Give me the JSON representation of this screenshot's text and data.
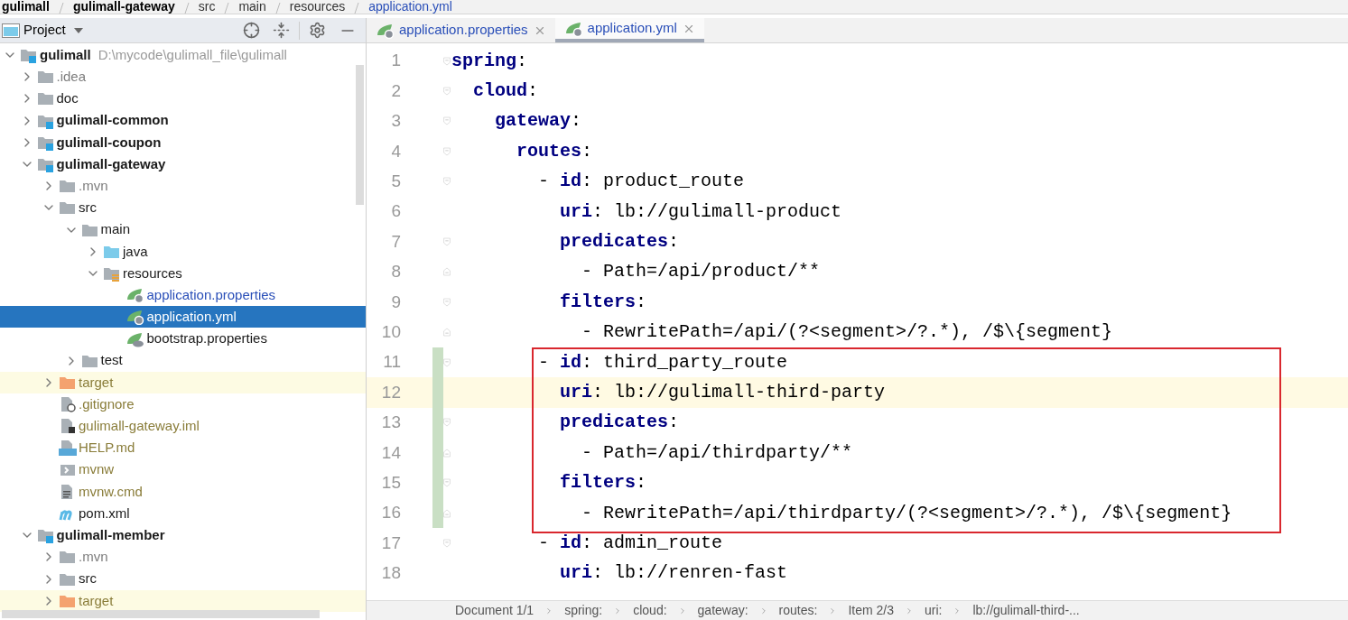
{
  "breadcrumbs": [
    "gulimall",
    "gulimall-gateway",
    "src",
    "main",
    "resources",
    "application.yml"
  ],
  "project_panel": {
    "title": "Project"
  },
  "tree": [
    {
      "label": "gulimall",
      "path": "D:\\mycode\\gulimall_file\\gulimall",
      "kind": "module",
      "color": "#1a1a1a",
      "expanded": true,
      "selected": false,
      "children": [
        {
          "label": ".idea",
          "kind": "folder",
          "color": "#7d7d7d",
          "expanded": false,
          "selected": false
        },
        {
          "label": "doc",
          "kind": "folder",
          "color": "#1a1a1a",
          "expanded": false,
          "selected": false
        },
        {
          "label": "gulimall-common",
          "kind": "module",
          "color": "#1a1a1a",
          "expanded": false,
          "selected": false
        },
        {
          "label": "gulimall-coupon",
          "kind": "module",
          "color": "#1a1a1a",
          "expanded": false,
          "selected": false
        },
        {
          "label": "gulimall-gateway",
          "kind": "module",
          "color": "#1a1a1a",
          "expanded": true,
          "selected": false,
          "children": [
            {
              "label": ".mvn",
              "kind": "folder",
              "color": "#7d7d7d",
              "expanded": false,
              "selected": false
            },
            {
              "label": "src",
              "kind": "folder",
              "color": "#1a1a1a",
              "expanded": true,
              "selected": false,
              "children": [
                {
                  "label": "main",
                  "kind": "folder",
                  "color": "#1a1a1a",
                  "expanded": true,
                  "selected": false,
                  "children": [
                    {
                      "label": "java",
                      "kind": "source-folder",
                      "color": "#1a1a1a",
                      "expanded": false,
                      "selected": false
                    },
                    {
                      "label": "resources",
                      "kind": "resource-folder",
                      "color": "#1a1a1a",
                      "expanded": true,
                      "selected": false,
                      "children": [
                        {
                          "label": "application.properties",
                          "kind": "spring-config",
                          "color": "#2a4fb8",
                          "selected": false
                        },
                        {
                          "label": "application.yml",
                          "kind": "spring-config",
                          "selected": true
                        },
                        {
                          "label": "bootstrap.properties",
                          "kind": "spring-bootstrap",
                          "color": "#1a1a1a",
                          "selected": false
                        }
                      ]
                    }
                  ]
                },
                {
                  "label": "test",
                  "kind": "folder",
                  "color": "#1a1a1a",
                  "expanded": false,
                  "selected": false
                }
              ]
            },
            {
              "label": "target",
              "kind": "excluded-folder",
              "color": "#8a7d3a",
              "expanded": false,
              "selected": false
            },
            {
              "label": ".gitignore",
              "kind": "ignore-file",
              "color": "#8a7d3a",
              "selected": false
            },
            {
              "label": "gulimall-gateway.iml",
              "kind": "iml-file",
              "color": "#8a7d3a",
              "selected": false
            },
            {
              "label": "HELP.md",
              "kind": "markdown-file",
              "color": "#8a7d3a",
              "selected": false
            },
            {
              "label": "mvnw",
              "kind": "shell-file",
              "color": "#8a7d3a",
              "selected": false
            },
            {
              "label": "mvnw.cmd",
              "kind": "text-file",
              "color": "#8a7d3a",
              "selected": false
            },
            {
              "label": "pom.xml",
              "kind": "maven-file",
              "color": "#1a1a1a",
              "selected": false
            }
          ]
        },
        {
          "label": "gulimall-member",
          "kind": "module",
          "color": "#1a1a1a",
          "expanded": true,
          "selected": false,
          "children": [
            {
              "label": ".mvn",
              "kind": "folder",
              "color": "#7d7d7d",
              "expanded": false,
              "selected": false
            },
            {
              "label": "src",
              "kind": "folder",
              "color": "#1a1a1a",
              "expanded": false,
              "selected": false
            },
            {
              "label": "target",
              "kind": "excluded-folder",
              "color": "#8a7d3a",
              "expanded": false,
              "selected": false
            }
          ]
        }
      ]
    }
  ],
  "tabs": [
    {
      "label": "application.properties",
      "selected": false
    },
    {
      "label": "application.yml",
      "selected": true
    }
  ],
  "code_lines": [
    {
      "number": "1",
      "code": "**spring**:",
      "fold_start": true,
      "fold_end": false,
      "changed": false,
      "current": false,
      "boxed": false
    },
    {
      "number": "2",
      "code": "  **cloud**:",
      "fold_start": true,
      "fold_end": false,
      "changed": false,
      "current": false,
      "boxed": false
    },
    {
      "number": "3",
      "code": "    **gateway**:",
      "fold_start": true,
      "fold_end": false,
      "changed": false,
      "current": false,
      "boxed": false
    },
    {
      "number": "4",
      "code": "      **routes**:",
      "fold_start": true,
      "fold_end": false,
      "changed": false,
      "current": false,
      "boxed": false
    },
    {
      "number": "5",
      "code": "        - **id**: product_route",
      "fold_start": true,
      "fold_end": false,
      "changed": false,
      "current": false,
      "boxed": false
    },
    {
      "number": "6",
      "code": "          **uri**: lb://gulimall-product",
      "fold_start": false,
      "fold_end": false,
      "changed": false,
      "current": false,
      "boxed": false
    },
    {
      "number": "7",
      "code": "          **predicates**:",
      "fold_start": true,
      "fold_end": false,
      "changed": false,
      "current": false,
      "boxed": false
    },
    {
      "number": "8",
      "code": "            - Path=/api/product/**",
      "fold_start": false,
      "fold_end": true,
      "changed": false,
      "current": false,
      "boxed": false
    },
    {
      "number": "9",
      "code": "          **filters**:",
      "fold_start": true,
      "fold_end": false,
      "changed": false,
      "current": false,
      "boxed": false
    },
    {
      "number": "10",
      "code": "            - RewritePath=/api/(?<segment>/?.*), /$\\{segment}",
      "fold_start": false,
      "fold_end": true,
      "changed": false,
      "current": false,
      "boxed": false
    },
    {
      "number": "11",
      "code": "        - **id**: third_party_route",
      "fold_start": true,
      "fold_end": false,
      "changed": true,
      "current": false,
      "boxed": true
    },
    {
      "number": "12",
      "code": "          **uri**: lb://gulimall-third-party",
      "fold_start": false,
      "fold_end": false,
      "changed": true,
      "current": true,
      "boxed": true
    },
    {
      "number": "13",
      "code": "          **predicates**:",
      "fold_start": true,
      "fold_end": false,
      "changed": true,
      "current": false,
      "boxed": true
    },
    {
      "number": "14",
      "code": "            - Path=/api/thirdparty/**",
      "fold_start": false,
      "fold_end": true,
      "changed": true,
      "current": false,
      "boxed": true
    },
    {
      "number": "15",
      "code": "          **filters**:",
      "fold_start": true,
      "fold_end": false,
      "changed": true,
      "current": false,
      "boxed": true
    },
    {
      "number": "16",
      "code": "            - RewritePath=/api/thirdparty/(?<segment>/?.*), /$\\{segment}",
      "fold_start": false,
      "fold_end": true,
      "changed": true,
      "current": false,
      "boxed": true
    },
    {
      "number": "17",
      "code": "        - **id**: admin_route",
      "fold_start": true,
      "fold_end": false,
      "changed": false,
      "current": false,
      "boxed": false
    },
    {
      "number": "18",
      "code": "          **uri**: lb://renren-fast",
      "fold_start": false,
      "fold_end": false,
      "changed": false,
      "current": false,
      "boxed": false
    }
  ],
  "status_bar": {
    "path": [
      "Document 1/1",
      "spring:",
      "cloud:",
      "gateway:",
      "routes:",
      "Item 2/3",
      "uri:",
      "lb://gulimall-third-..."
    ]
  }
}
